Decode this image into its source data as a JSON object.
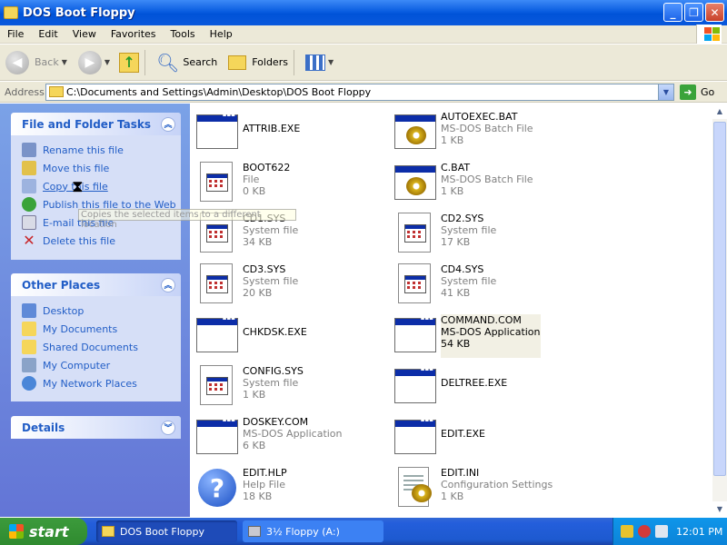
{
  "window": {
    "title": "DOS Boot Floppy"
  },
  "menu": [
    "File",
    "Edit",
    "View",
    "Favorites",
    "Tools",
    "Help"
  ],
  "toolbar": {
    "back": "Back",
    "search": "Search",
    "folders": "Folders"
  },
  "address": {
    "label": "Address",
    "path": "C:\\Documents and Settings\\Admin\\Desktop\\DOS Boot Floppy",
    "go": "Go"
  },
  "tasks_panel": {
    "title": "File and Folder Tasks",
    "items": [
      "Rename this file",
      "Move this file",
      "Copy this file",
      "Publish this file to the Web",
      "E-mail this file",
      "Delete this file"
    ]
  },
  "places_panel": {
    "title": "Other Places",
    "items": [
      "Desktop",
      "My Documents",
      "Shared Documents",
      "My Computer",
      "My Network Places"
    ]
  },
  "details_panel": {
    "title": "Details"
  },
  "tooltip": "Copies the selected items to a different location",
  "files": [
    {
      "name": "ATTRIB.EXE",
      "type": "",
      "size": "",
      "icon": "exe"
    },
    {
      "name": "AUTOEXEC.BAT",
      "type": "MS-DOS Batch File",
      "size": "1 KB",
      "icon": "bat"
    },
    {
      "name": "BOOT622",
      "type": "File",
      "size": "0 KB",
      "icon": "sys"
    },
    {
      "name": "C.BAT",
      "type": "MS-DOS Batch File",
      "size": "1 KB",
      "icon": "bat"
    },
    {
      "name": "CD1.SYS",
      "type": "System file",
      "size": "34 KB",
      "icon": "sys"
    },
    {
      "name": "CD2.SYS",
      "type": "System file",
      "size": "17 KB",
      "icon": "sys"
    },
    {
      "name": "CD3.SYS",
      "type": "System file",
      "size": "20 KB",
      "icon": "sys"
    },
    {
      "name": "CD4.SYS",
      "type": "System file",
      "size": "41 KB",
      "icon": "sys"
    },
    {
      "name": "CHKDSK.EXE",
      "type": "",
      "size": "",
      "icon": "exe"
    },
    {
      "name": "COMMAND.COM",
      "type": "MS-DOS Application",
      "size": "54 KB",
      "icon": "exe"
    },
    {
      "name": "CONFIG.SYS",
      "type": "System file",
      "size": "1 KB",
      "icon": "sys"
    },
    {
      "name": "DELTREE.EXE",
      "type": "",
      "size": "",
      "icon": "exe"
    },
    {
      "name": "DOSKEY.COM",
      "type": "MS-DOS Application",
      "size": "6 KB",
      "icon": "exe"
    },
    {
      "name": "EDIT.EXE",
      "type": "",
      "size": "",
      "icon": "exe"
    },
    {
      "name": "EDIT.HLP",
      "type": "Help File",
      "size": "18 KB",
      "icon": "hlp"
    },
    {
      "name": "EDIT.INI",
      "type": "Configuration Settings",
      "size": "1 KB",
      "icon": "ini"
    }
  ],
  "taskbar": {
    "start": "start",
    "tabs": [
      "DOS Boot Floppy",
      "3½ Floppy (A:)"
    ],
    "clock": "12:01 PM"
  }
}
